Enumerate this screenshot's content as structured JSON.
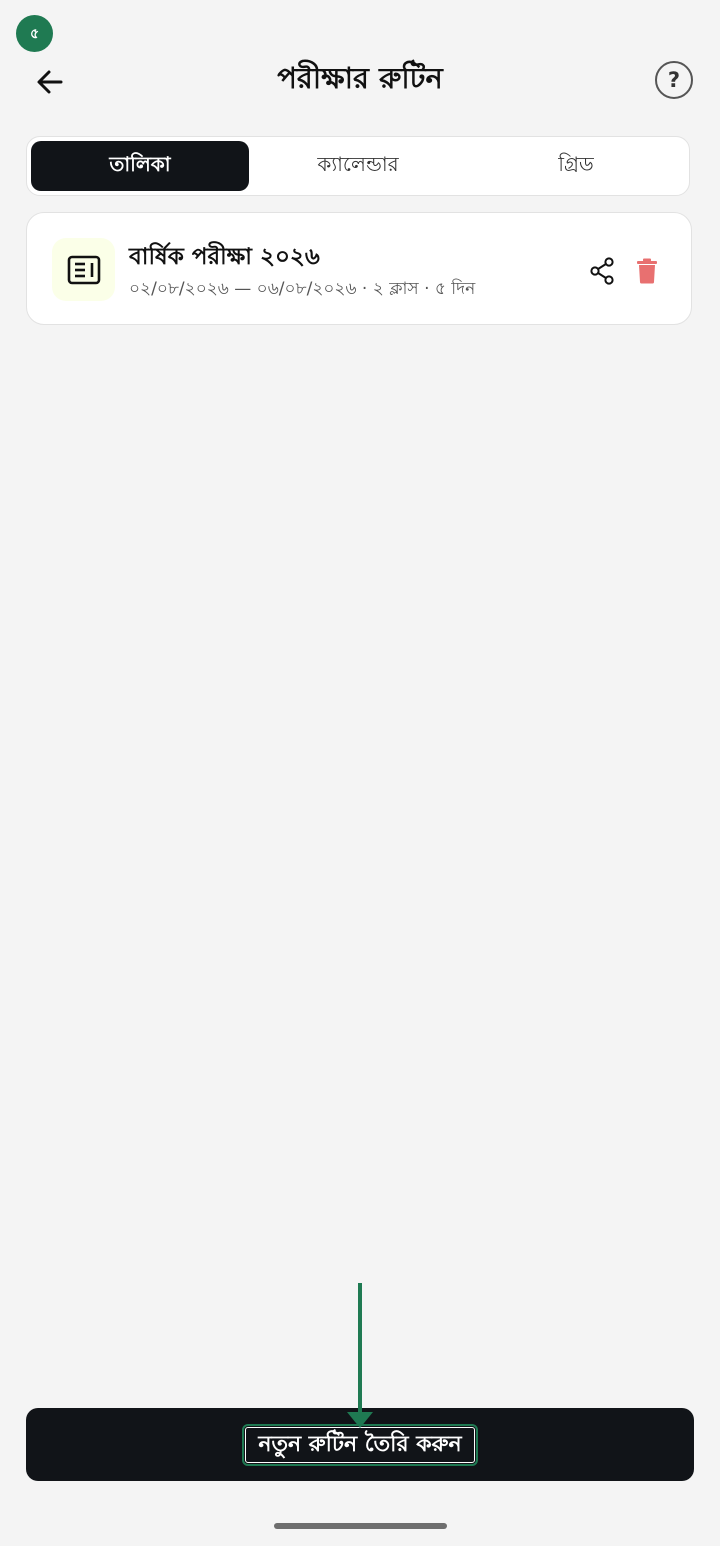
{
  "status_badge": "৫",
  "header": {
    "title": "পরীক্ষার রুটিন",
    "help_label": "?"
  },
  "tabs": [
    {
      "label": "তালিকা",
      "active": true
    },
    {
      "label": "ক্যালেন্ডার",
      "active": false
    },
    {
      "label": "গ্রিড",
      "active": false
    }
  ],
  "routine_card": {
    "title": "বার্ষিক পরীক্ষা ২০২৬",
    "subtitle": "০২/০৮/২০২৬ — ০৬/০৮/২০২৬ · ২ ক্লাস · ৫ দিন",
    "icon": "newspaper-icon"
  },
  "create_button": {
    "label": "নতুন রুটিন তৈরি করুন"
  },
  "colors": {
    "accent": "#1f7a52",
    "dark": "#111418",
    "delete": "#e87070",
    "background": "#f4f4f4"
  }
}
